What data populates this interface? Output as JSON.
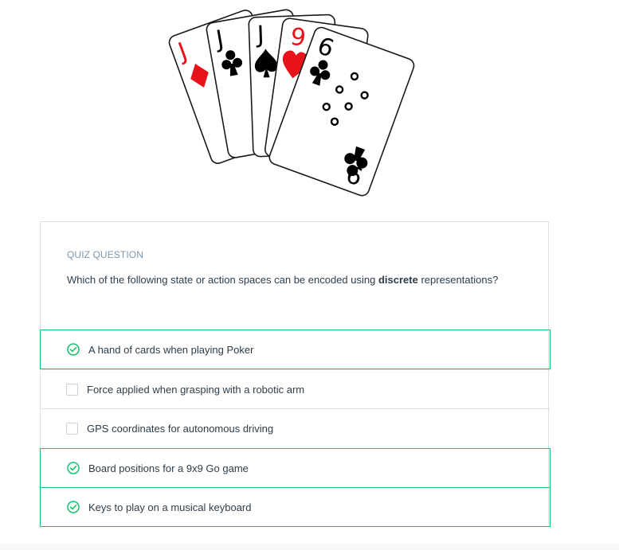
{
  "figure": {
    "cards": [
      {
        "rank": "J",
        "suit": "diamonds",
        "color": "#e8121b"
      },
      {
        "rank": "J",
        "suit": "clubs",
        "color": "#000000"
      },
      {
        "rank": "J",
        "suit": "spades",
        "color": "#000000"
      },
      {
        "rank": "9",
        "suit": "hearts",
        "color": "#e8121b"
      },
      {
        "rank": "6",
        "suit": "clubs",
        "color": "#000000"
      }
    ],
    "front_card_bottom_rank": "9"
  },
  "quiz": {
    "kicker": "QUIZ QUESTION",
    "prompt_before": "Which of the following state or action spaces can be encoded using ",
    "prompt_bold": "discrete",
    "prompt_after": " representations?",
    "options": [
      {
        "label": "A hand of cards when playing Poker",
        "selected": true
      },
      {
        "label": "Force applied when grasping with a robotic arm",
        "selected": false
      },
      {
        "label": "GPS coordinates for autonomous driving",
        "selected": false
      },
      {
        "label": "Board positions for a 9x9 Go game",
        "selected": true
      },
      {
        "label": "Keys to play on a musical keyboard",
        "selected": true
      }
    ]
  },
  "colors": {
    "selected_border": "#15c26b",
    "check_green": "#15c26b",
    "kicker": "#7d97ad",
    "text": "#2e3d49"
  }
}
